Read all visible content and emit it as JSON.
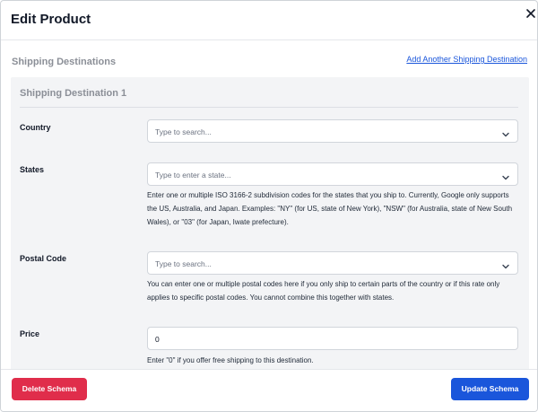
{
  "modal": {
    "title": "Edit Product"
  },
  "section": {
    "title": "Shipping Destinations",
    "add_link": "Add Another Shipping Destination"
  },
  "destination": {
    "title": "Shipping Destination 1",
    "country": {
      "label": "Country",
      "placeholder": "Type to search..."
    },
    "states": {
      "label": "States",
      "placeholder": "Type to enter a state...",
      "help": "Enter one or multiple ISO 3166-2 subdivision codes for the states that you ship to. Currently, Google only supports the US, Australia, and Japan. Examples: \"NY\" (for US, state of New York), \"NSW\" (for Australia, state of New South Wales), or \"03\" (for Japan, Iwate prefecture)."
    },
    "postal_code": {
      "label": "Postal Code",
      "placeholder": "Type to search...",
      "help": "You can enter one or multiple postal codes here if you only ship to certain parts of the country or if this rate only applies to specific postal codes. You cannot combine this together with states."
    },
    "price": {
      "label": "Price",
      "value": "0",
      "help": "Enter \"0\" if you offer free shipping to this destination."
    }
  },
  "footer": {
    "delete_label": "Delete Schema",
    "update_label": "Update Schema"
  },
  "colors": {
    "delete": "#e02d4b",
    "update": "#1a56db",
    "link": "#1a56db",
    "panel": "#f3f4f6"
  },
  "icons": {
    "close": "close-icon",
    "dropdown": "chevron-down-icon"
  }
}
